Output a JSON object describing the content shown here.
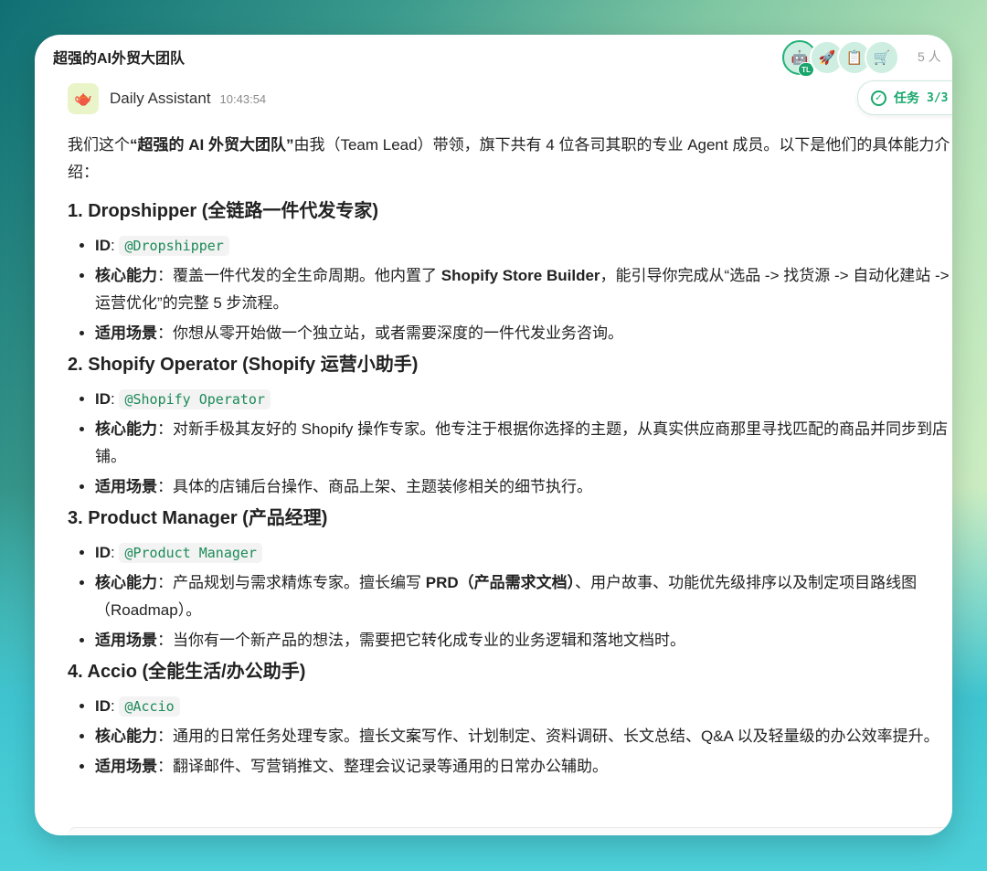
{
  "window": {
    "title": "超强的AI外贸大团队",
    "member_count": "5 人"
  },
  "avatars": [
    {
      "icon": "teapot-robot-icon",
      "glyph": "🤖",
      "badge": "TL"
    },
    {
      "icon": "rocket-icon",
      "glyph": "🚀"
    },
    {
      "icon": "document-icon",
      "glyph": "📋"
    },
    {
      "icon": "cart-icon",
      "glyph": "🛒"
    }
  ],
  "message": {
    "sender": "Daily Assistant",
    "time": "10:43:54",
    "task_label": "任务",
    "task_progress": "3/3",
    "intro": {
      "pre": "我们这个",
      "bold": "“超强的 AI 外贸大团队”",
      "post": "由我（Team Lead）带领，旗下共有 4 位各司其职的专业 Agent 成员。以下是他们的具体能力介绍："
    },
    "members": [
      {
        "heading": "1. Dropshipper (全链路一件代发专家)",
        "id_label": "ID",
        "id": "@Dropshipper",
        "core_label": "核心能力",
        "core_pre": "：覆盖一件代发的全生命周期。他内置了 ",
        "core_bold": "Shopify Store Builder",
        "core_post": "，能引导你完成从“选品 -> 找货源 -> 自动化建站 -> 运营优化”的完整 5 步流程。",
        "scene_label": "适用场景",
        "scene": "：你想从零开始做一个独立站，或者需要深度的一件代发业务咨询。"
      },
      {
        "heading": "2. Shopify Operator (Shopify 运营小助手)",
        "id_label": "ID",
        "id": "@Shopify Operator",
        "core_label": "核心能力",
        "core_pre": "：对新手极其友好的 Shopify 操作专家。他专注于根据你选择的主题，从真实供应商那里寻找匹配的商品并同步到店铺。",
        "core_bold": "",
        "core_post": "",
        "scene_label": "适用场景",
        "scene": "：具体的店铺后台操作、商品上架、主题装修相关的细节执行。"
      },
      {
        "heading": "3. Product Manager (产品经理)",
        "id_label": "ID",
        "id": "@Product Manager",
        "core_label": "核心能力",
        "core_pre": "：产品规划与需求精炼专家。擅长编写 ",
        "core_bold": "PRD（产品需求文档）",
        "core_post": "、用户故事、功能优先级排序以及制定项目路线图（Roadmap）。",
        "scene_label": "适用场景",
        "scene": "：当你有一个新产品的想法，需要把它转化成专业的业务逻辑和落地文档时。"
      },
      {
        "heading": "4. Accio (全能生活/办公助手)",
        "id_label": "ID",
        "id": "@Accio",
        "core_label": "核心能力",
        "core_pre": "：通用的日常任务处理专家。擅长文案写作、计划制定、资料调研、长文总结、Q&A 以及轻量级的办公效率提升。",
        "core_bold": "",
        "core_post": "",
        "scene_label": "适用场景",
        "scene": "：翻译邮件、写营销推文、整理会议记录等通用的日常办公辅助。"
      }
    ]
  }
}
